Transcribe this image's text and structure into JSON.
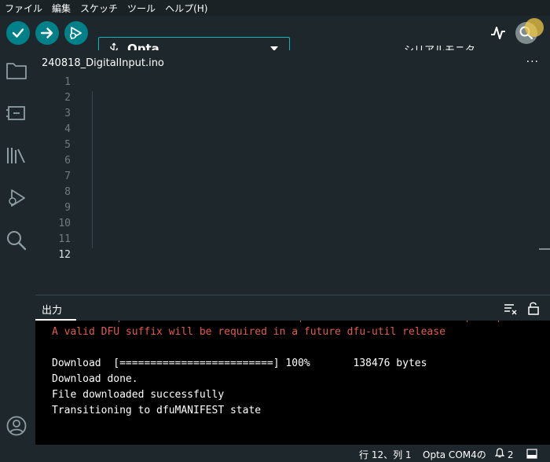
{
  "menubar": {
    "items": [
      "ファイル",
      "編集",
      "スケッチ",
      "ツール",
      "ヘルプ(H)"
    ]
  },
  "toolbar": {
    "verify_icon": "check-icon",
    "upload_icon": "arrow-right-icon",
    "debug_icon": "debug-icon",
    "board_icon": "usb-icon",
    "board_name": "Opta",
    "serial_plotter_icon": "pulse-icon",
    "serial_monitor_label": "シリアルモニタ",
    "serial_monitor_icon": "magnifier-icon",
    "accent": "#00818a"
  },
  "sidebar": {
    "icons": [
      "folder-icon",
      "board-manager-icon",
      "library-icon",
      "debug-icon",
      "search-icon",
      "account-icon"
    ]
  },
  "tab": {
    "filename": "240818_DigitalInput.ino",
    "more_label": "···"
  },
  "editor": {
    "line_numbers": [
      "1",
      "2",
      "3",
      "4",
      "5",
      "6",
      "7",
      "8",
      "9",
      "10",
      "11",
      "12"
    ],
    "active_line": "12"
  },
  "output": {
    "label": "出力",
    "clear_icon": "clear-output-icon",
    "lock_icon": "unlock-icon",
    "lines": [
      "A valid DFU suffix will be required in a future dfu-util release",
      "",
      "Download  [=========================] 100%       138476 bytes",
      "Download done.",
      "File downloaded successfully",
      "Transitioning to dfuMANIFEST state"
    ],
    "error_color": "#e05c4d"
  },
  "status": {
    "cursor_position": "行 12、列 1",
    "board_port": "Opta COM4の",
    "notifications_icon": "bell-icon",
    "notifications_count": "2",
    "panel_icon": "panel-icon"
  }
}
